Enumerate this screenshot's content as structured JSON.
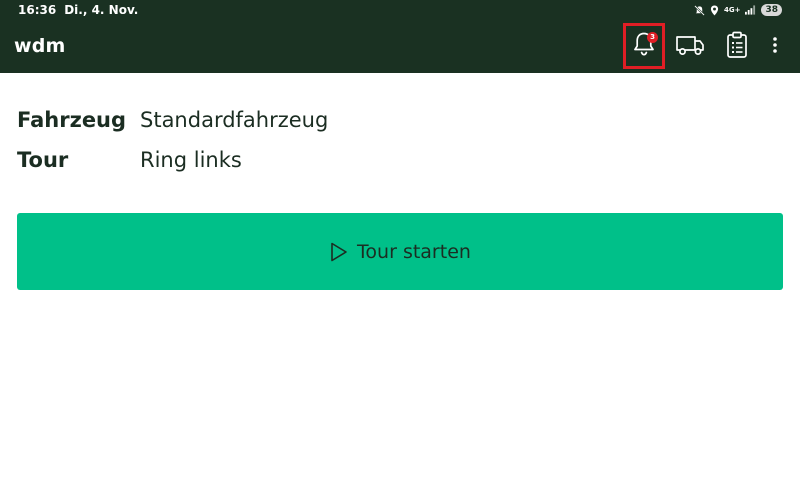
{
  "status_bar": {
    "time": "16:36",
    "date": "Di., 4. Nov.",
    "network": "4G+",
    "battery": "38",
    "icons": [
      "mute-icon",
      "location-icon",
      "network-icon",
      "signal-icon",
      "battery-icon"
    ]
  },
  "app_bar": {
    "title": "wdm",
    "notification_count": "3",
    "actions": [
      "bell-icon",
      "truck-icon",
      "clipboard-icon",
      "more-vert-icon"
    ],
    "highlight_color": "#e01e25"
  },
  "details": {
    "vehicle_label": "Fahrzeug",
    "vehicle_value": "Standardfahrzeug",
    "tour_label": "Tour",
    "tour_value": "Ring links"
  },
  "start_button": {
    "label": "Tour starten",
    "icon": "play-icon"
  },
  "colors": {
    "app_bar_bg": "#1a3122",
    "accent": "#00c089",
    "text": "#1b2d22"
  }
}
